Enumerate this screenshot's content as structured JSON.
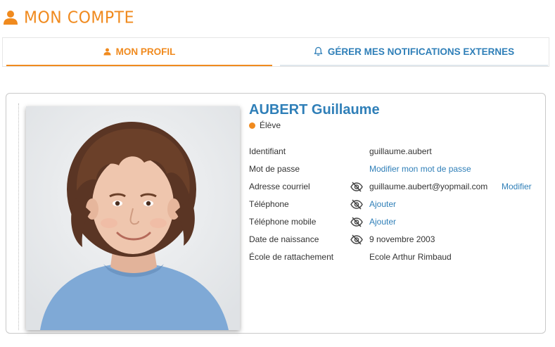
{
  "header": {
    "title": "MON COMPTE",
    "icon": "user-icon",
    "accent": "#f08a1e"
  },
  "tabs": [
    {
      "label": "MON PROFIL",
      "icon": "user-icon",
      "active": true
    },
    {
      "label": "GÉRER MES NOTIFICATIONS EXTERNES",
      "icon": "bell-icon",
      "active": false
    }
  ],
  "profile": {
    "name": "AUBERT Guillaume",
    "role": "Élève",
    "role_color": "#f08a1e",
    "fields": {
      "identifiant": {
        "label": "Identifiant",
        "value": "guillaume.aubert"
      },
      "password": {
        "label": "Mot de passe",
        "value": "Modifier mon mot de passe"
      },
      "email": {
        "label": "Adresse courriel",
        "value": "guillaume.aubert@yopmail.com",
        "action": "Modifier",
        "icon": "eye-slash-icon"
      },
      "phone": {
        "label": "Téléphone",
        "value": "Ajouter",
        "icon": "eye-slash-icon"
      },
      "mobile": {
        "label": "Téléphone mobile",
        "value": "Ajouter",
        "icon": "eye-slash-icon"
      },
      "birthdate": {
        "label": "Date de naissance",
        "value": "9 novembre 2003",
        "icon": "eye-slash-icon"
      },
      "school": {
        "label": "École de rattachement",
        "value": "Ecole Arthur Rimbaud"
      }
    }
  },
  "colors": {
    "accent": "#f08a1e",
    "link": "#2f7fb8"
  }
}
